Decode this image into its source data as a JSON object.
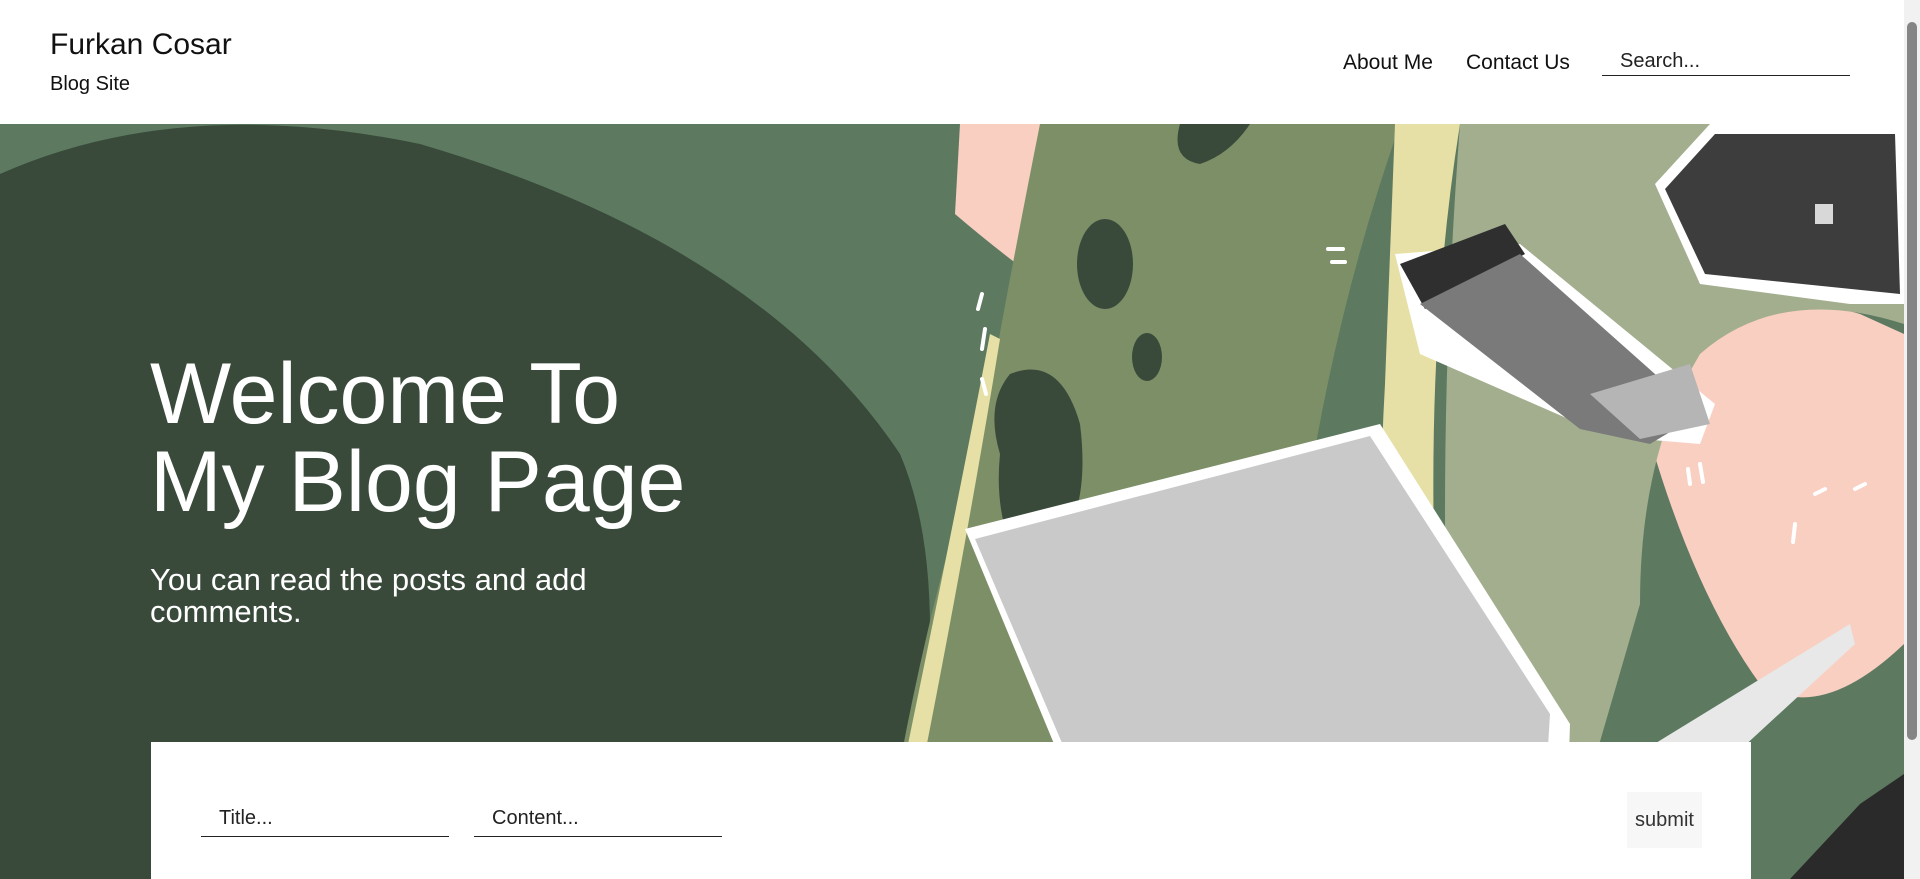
{
  "header": {
    "brand_title": "Furkan Cosar",
    "brand_subtitle": "Blog Site",
    "nav": {
      "about": "About Me",
      "contact": "Contact Us"
    },
    "search_placeholder": "Search..."
  },
  "hero": {
    "title_line1": "Welcome To",
    "title_line2": "My Blog Page",
    "subtitle": "You can read the posts and add comments."
  },
  "post_form": {
    "title_placeholder": "Title...",
    "content_placeholder": "Content...",
    "submit_label": "submit"
  },
  "icons": [
    "coffee-cup-illustration",
    "laptop-illustration",
    "briefcase-illustration"
  ],
  "colors": {
    "hero_dark": "#394a3b",
    "hero_mid": "#5d7a60",
    "hero_olive": "#7d8f67",
    "hero_pink": "#f9cfc2",
    "hero_cream": "#e6e0a6"
  }
}
